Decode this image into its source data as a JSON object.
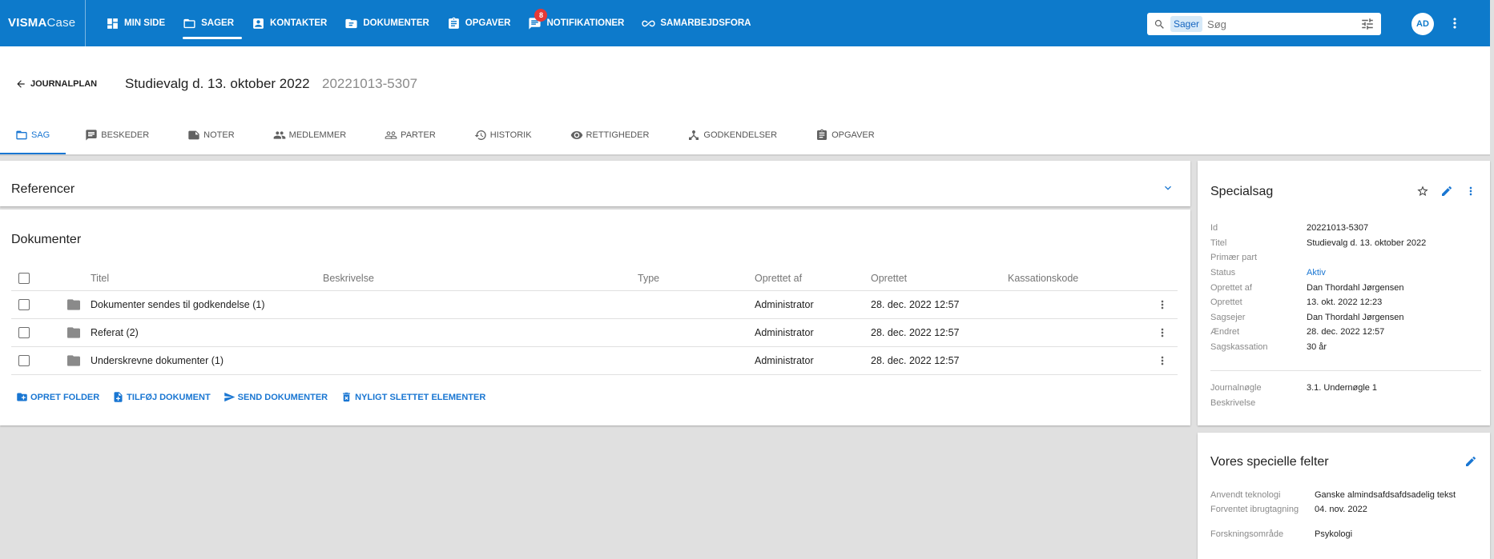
{
  "app": {
    "logo_brand": "VISMA",
    "logo_product": "Case"
  },
  "nav": [
    {
      "label": "MIN SIDE",
      "icon": "dashboard-icon"
    },
    {
      "label": "SAGER",
      "icon": "folder-icon",
      "active": true
    },
    {
      "label": "KONTAKTER",
      "icon": "contact-icon"
    },
    {
      "label": "DOKUMENTER",
      "icon": "document-folder-icon"
    },
    {
      "label": "OPGAVER",
      "icon": "clipboard-icon"
    },
    {
      "label": "NOTIFIKATIONER",
      "icon": "chat-icon",
      "badge": "8"
    },
    {
      "label": "SAMARBEJDSFORA",
      "icon": "link-icon"
    }
  ],
  "search": {
    "scope": "Sager",
    "placeholder": "Søg"
  },
  "user": {
    "initials": "AD"
  },
  "header": {
    "back_label": "JOURNALPLAN",
    "title": "Studievalg d. 13. oktober 2022",
    "case_id": "20221013-5307"
  },
  "tabs": [
    {
      "label": "SAG",
      "icon": "folder-icon",
      "active": true
    },
    {
      "label": "BESKEDER",
      "icon": "message-icon"
    },
    {
      "label": "NOTER",
      "icon": "note-icon"
    },
    {
      "label": "MEDLEMMER",
      "icon": "people-icon"
    },
    {
      "label": "PARTER",
      "icon": "people-outline-icon"
    },
    {
      "label": "HISTORIK",
      "icon": "history-icon"
    },
    {
      "label": "RETTIGHEDER",
      "icon": "eye-icon"
    },
    {
      "label": "GODKENDELSER",
      "icon": "approval-icon"
    },
    {
      "label": "OPGAVER",
      "icon": "clipboard-icon"
    }
  ],
  "references": {
    "title": "Referencer"
  },
  "documents": {
    "title": "Dokumenter",
    "columns": [
      "Titel",
      "Beskrivelse",
      "Type",
      "Oprettet af",
      "Oprettet",
      "Kassationskode"
    ],
    "rows": [
      {
        "title": "Dokumenter sendes til godkendelse (1)",
        "description": "",
        "type": "",
        "created_by": "Administrator",
        "created": "28. dec. 2022 12:57",
        "disposal_code": ""
      },
      {
        "title": "Referat (2)",
        "description": "",
        "type": "",
        "created_by": "Administrator",
        "created": "28. dec. 2022 12:57",
        "disposal_code": ""
      },
      {
        "title": "Underskrevne dokumenter (1)",
        "description": "",
        "type": "",
        "created_by": "Administrator",
        "created": "28. dec. 2022 12:57",
        "disposal_code": ""
      }
    ],
    "actions": [
      "OPRET FOLDER",
      "TILFØJ DOKUMENT",
      "SEND DOKUMENTER",
      "NYLIGT SLETTET ELEMENTER"
    ]
  },
  "case_info": {
    "title": "Specialsag",
    "fields": [
      {
        "label": "Id",
        "value": "20221013-5307"
      },
      {
        "label": "Titel",
        "value": "Studievalg d. 13. oktober 2022"
      },
      {
        "label": "Primær part",
        "value": ""
      },
      {
        "label": "Status",
        "value": "Aktiv"
      },
      {
        "label": "Oprettet af",
        "value": "Dan Thordahl Jørgensen"
      },
      {
        "label": "Oprettet",
        "value": "13. okt. 2022 12:23"
      },
      {
        "label": "Sagsejer",
        "value": "Dan Thordahl Jørgensen"
      },
      {
        "label": "Ændret",
        "value": "28. dec. 2022 12:57"
      },
      {
        "label": "Sagskassation",
        "value": "30 år"
      }
    ],
    "extra_fields": [
      {
        "label": "Journalnøgle",
        "value": "3.1. Undernøgle 1"
      },
      {
        "label": "Beskrivelse",
        "value": ""
      }
    ]
  },
  "special_fields": {
    "title": "Vores specielle felter",
    "fields": [
      {
        "label": "Anvendt teknologi",
        "value": "Ganske almindsafdsafdsadelig tekst"
      },
      {
        "label": "Forventet ibrugtagning",
        "value": "04. nov. 2022"
      },
      {
        "label": "Forskningsområde",
        "value": "Psykologi"
      }
    ]
  },
  "colors": {
    "primary": "#0d7acb",
    "accent": "#1976d2",
    "badge": "#e53935"
  }
}
